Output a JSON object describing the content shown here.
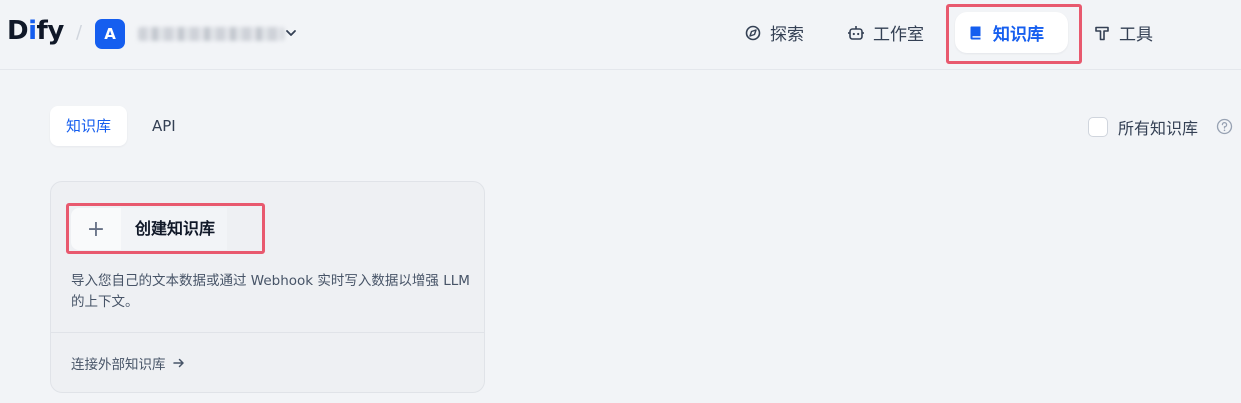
{
  "header": {
    "logo_prefix": "D",
    "logo_i": "i",
    "logo_suffix": "fy",
    "workspace_initial": "A",
    "nav": {
      "explore": "探索",
      "studio": "工作室",
      "knowledge": "知识库",
      "tools": "工具"
    }
  },
  "tabs": [
    {
      "label": "知识库",
      "active": true
    },
    {
      "label": "API",
      "active": false
    }
  ],
  "filter": {
    "all_knowledge_label": "所有知识库",
    "checked": false
  },
  "create_card": {
    "button_label": "创建知识库",
    "description": "导入您自己的文本数据或通过 Webhook 实时写入数据以增强 LLM 的上下文。",
    "connect_label": "连接外部知识库"
  },
  "colors": {
    "accent": "#155eef",
    "highlight": "#e8596e",
    "background": "#f2f4f7"
  }
}
